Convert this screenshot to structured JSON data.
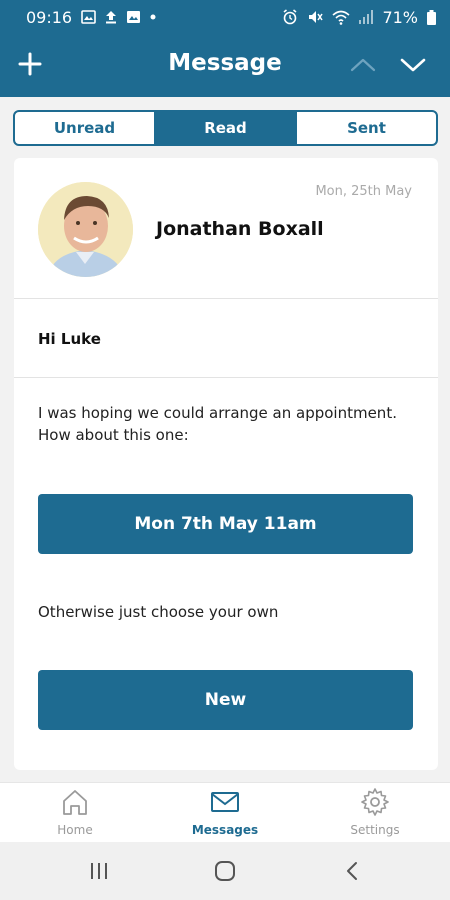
{
  "status_bar": {
    "time": "09:16",
    "battery": "71%",
    "left_icons": [
      "gallery-icon",
      "upload-icon",
      "image-icon",
      "dot-icon"
    ],
    "right_icons": [
      "alarm-icon",
      "mute-icon",
      "wifi-icon",
      "signal-icon",
      "battery-icon"
    ]
  },
  "header": {
    "title": "Message",
    "add_icon": "plus-icon",
    "prev_icon": "chevron-up-icon",
    "next_icon": "chevron-down-icon"
  },
  "tabs": [
    {
      "label": "Unread",
      "active": false
    },
    {
      "label": "Read",
      "active": true
    },
    {
      "label": "Sent",
      "active": false
    }
  ],
  "message": {
    "date": "Mon, 25th May",
    "sender": "Jonathan Boxall",
    "greeting": "Hi Luke",
    "body": "I was hoping we could arrange an appointment. How about this one:",
    "appointment_button": "Mon 7th May 11am",
    "alternative_text": "Otherwise just choose your own",
    "new_button": "New"
  },
  "bottom_nav": [
    {
      "label": "Home",
      "icon": "home-icon",
      "active": false
    },
    {
      "label": "Messages",
      "icon": "envelope-icon",
      "active": true
    },
    {
      "label": "Settings",
      "icon": "gear-icon",
      "active": false
    }
  ],
  "system_nav": {
    "icons": [
      "recent-apps-icon",
      "home-circle-icon",
      "back-icon"
    ]
  },
  "colors": {
    "brand": "#1e6b91",
    "inactive_nav": "#9a9a9a",
    "date_text": "#aaaaaa"
  }
}
